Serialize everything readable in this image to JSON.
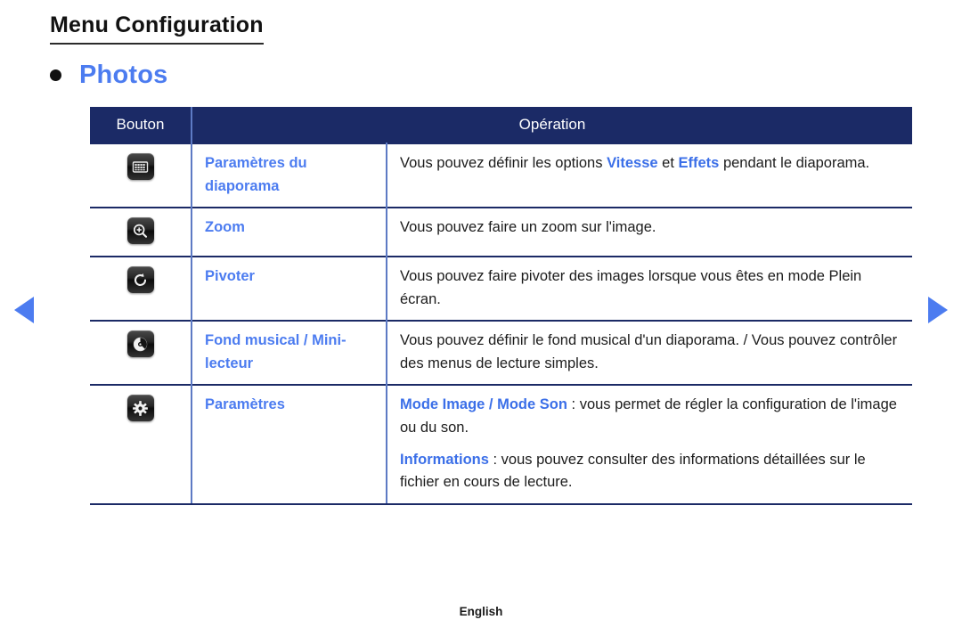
{
  "page": {
    "title": "Menu Configuration",
    "section_bullet_label": "Photos",
    "footer_language": "English"
  },
  "nav": {
    "prev_label": "◀",
    "next_label": "▶"
  },
  "colors": {
    "header_bg": "#1b2a66",
    "accent_blue": "#4c7cf0",
    "highlight_blue": "#3b6fe8",
    "border_blue": "#5d7ac4",
    "text": "#1c1c1c",
    "page_bg": "#ffffff"
  },
  "table": {
    "columns": [
      "Bouton",
      "Opération"
    ],
    "rows": [
      {
        "icon": "slideshow-settings-icon",
        "name": "Paramètres du diaporama",
        "description_parts": [
          [
            {
              "text": "Vous pouvez définir les options ",
              "highlight": false
            },
            {
              "text": "Vitesse",
              "highlight": true
            },
            {
              "text": " et ",
              "highlight": false
            },
            {
              "text": "Effets",
              "highlight": true
            },
            {
              "text": " pendant le diaporama.",
              "highlight": false
            }
          ]
        ]
      },
      {
        "icon": "zoom-icon",
        "name": "Zoom",
        "description_parts": [
          [
            {
              "text": "Vous pouvez faire un zoom sur l'image.",
              "highlight": false
            }
          ]
        ]
      },
      {
        "icon": "rotate-icon",
        "name": "Pivoter",
        "description_parts": [
          [
            {
              "text": "Vous pouvez faire pivoter des images lorsque vous êtes en mode Plein écran.",
              "highlight": false
            }
          ]
        ]
      },
      {
        "icon": "music-disc-icon",
        "name": "Fond musical / Mini-lecteur",
        "description_parts": [
          [
            {
              "text": "Vous pouvez définir le fond musical d'un diaporama. / Vous pouvez contrôler des menus de lecture simples.",
              "highlight": false
            }
          ]
        ]
      },
      {
        "icon": "gear-settings-icon",
        "name": "Paramètres",
        "description_parts": [
          [
            {
              "text": "Mode Image / Mode Son",
              "highlight": true
            },
            {
              "text": " : vous permet de régler la configuration de l'image ou du son.",
              "highlight": false
            }
          ],
          [
            {
              "text": "Informations",
              "highlight": true
            },
            {
              "text": " : vous pouvez consulter des informations détaillées sur le fichier en cours de lecture.",
              "highlight": false
            }
          ]
        ]
      }
    ]
  }
}
